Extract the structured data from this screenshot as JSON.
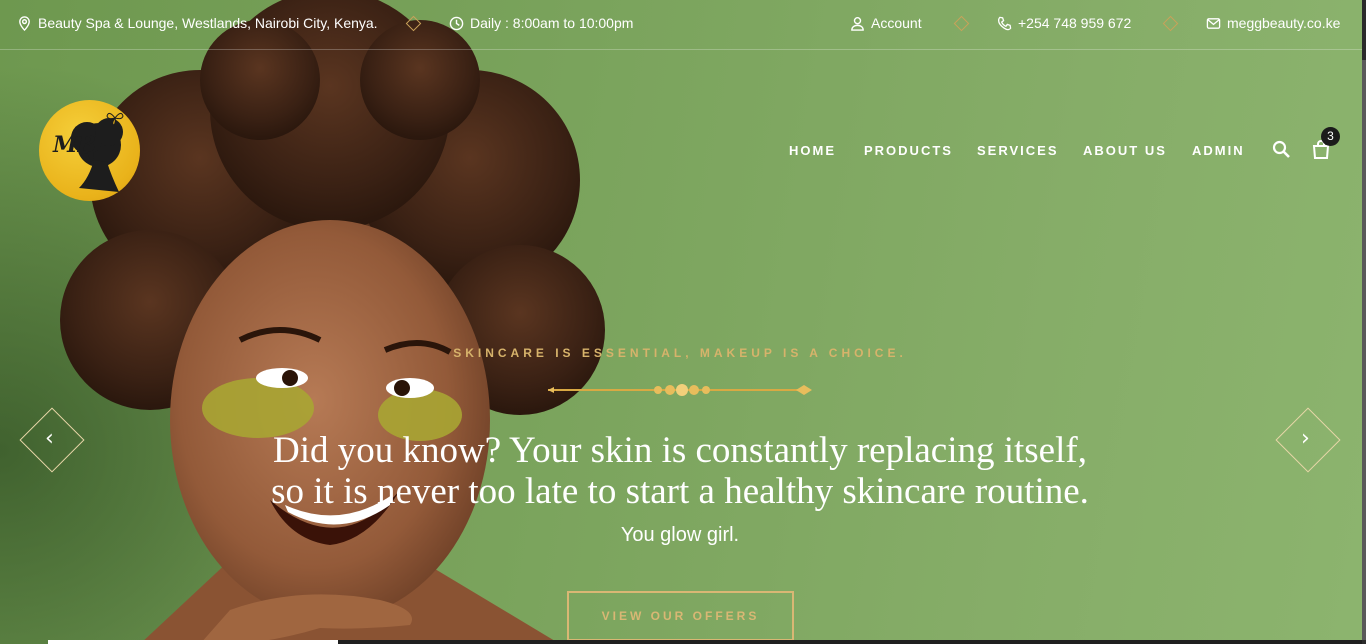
{
  "topbar": {
    "address": "Beauty Spa & Lounge, Westlands, Nairobi City, Kenya.",
    "hours": "Daily : 8:00am to 10:00pm",
    "account": "Account",
    "phone": "+254 748 959 672",
    "email": "meggbeauty.co.ke"
  },
  "logo": {
    "text": "MB"
  },
  "nav": {
    "items": [
      "HOME",
      "PRODUCTS",
      "SERVICES",
      "ABOUT US",
      "ADMIN"
    ],
    "cart_count": "3"
  },
  "hero": {
    "tagline": "SKINCARE IS ESSENTIAL, MAKEUP IS A CHOICE.",
    "headline_line1": "Did you know? Your skin is constantly replacing itself,",
    "headline_line2": "so it is never too late to start a healthy skincare routine.",
    "subtitle": "You glow girl.",
    "cta": "VIEW OUR OFFERS",
    "prev": "‹",
    "next": "›"
  },
  "colors": {
    "accent": "#d7b36b",
    "background": "#7ea65f",
    "logo": "#f0c22e"
  },
  "icons": [
    "location-icon",
    "clock-icon",
    "user-icon",
    "phone-icon",
    "mail-icon",
    "search-icon",
    "cart-icon",
    "chevron-left-icon",
    "chevron-right-icon",
    "butterfly-icon"
  ]
}
